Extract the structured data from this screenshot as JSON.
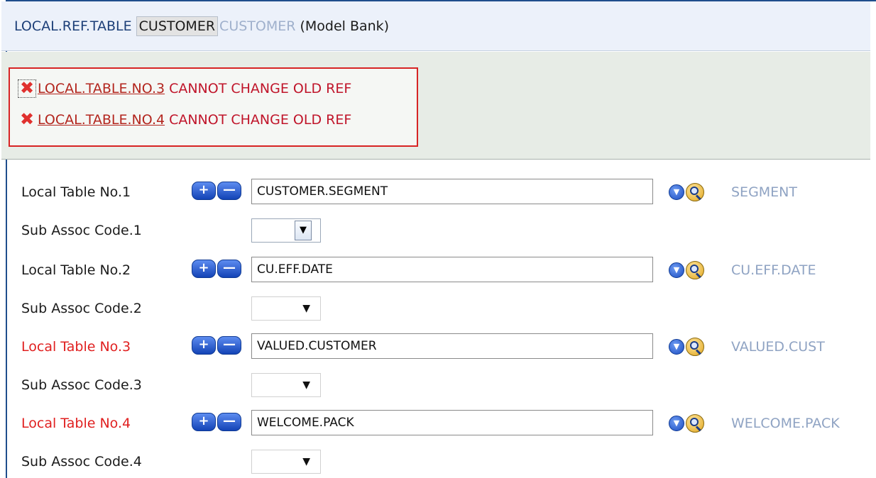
{
  "header": {
    "app": "LOCAL.REF.TABLE",
    "record_id": "CUSTOMER",
    "record_faded": "CUSTOMER",
    "company": "(Model Bank)"
  },
  "errors": [
    {
      "link": "LOCAL.TABLE.NO.3",
      "message": "CANNOT CHANGE OLD REF"
    },
    {
      "link": "LOCAL.TABLE.NO.4",
      "message": "CANNOT CHANGE OLD REF"
    }
  ],
  "fields": [
    {
      "label": "Local Table No.1",
      "value": "CUSTOMER.SEGMENT",
      "enrichment": "SEGMENT",
      "error": false
    },
    {
      "label": "Sub Assoc Code.1",
      "value": "",
      "active": true
    },
    {
      "label": "Local Table No.2",
      "value": "CU.EFF.DATE",
      "enrichment": "CU.EFF.DATE",
      "error": false
    },
    {
      "label": "Sub Assoc Code.2",
      "value": ""
    },
    {
      "label": "Local Table No.3",
      "value": "VALUED.CUSTOMER",
      "enrichment": "VALUED.CUST",
      "error": true
    },
    {
      "label": "Sub Assoc Code.3",
      "value": ""
    },
    {
      "label": "Local Table No.4",
      "value": "WELCOME.PACK",
      "enrichment": "WELCOME.PACK",
      "error": true
    },
    {
      "label": "Sub Assoc Code.4",
      "value": ""
    }
  ],
  "icons": {
    "plus": "plus-icon",
    "minus": "minus-icon",
    "dropdown": "chevron-down-icon",
    "lookup": "magnifier-icon",
    "error": "error-x-icon"
  },
  "symbols": {
    "plus": "+",
    "minus": "—",
    "x": "✖",
    "caret": "▾",
    "down": "▼"
  },
  "colors": {
    "error_text": "#c0152a",
    "enrichment": "#8fa3c3",
    "header_bg": "#ecf1fa"
  }
}
